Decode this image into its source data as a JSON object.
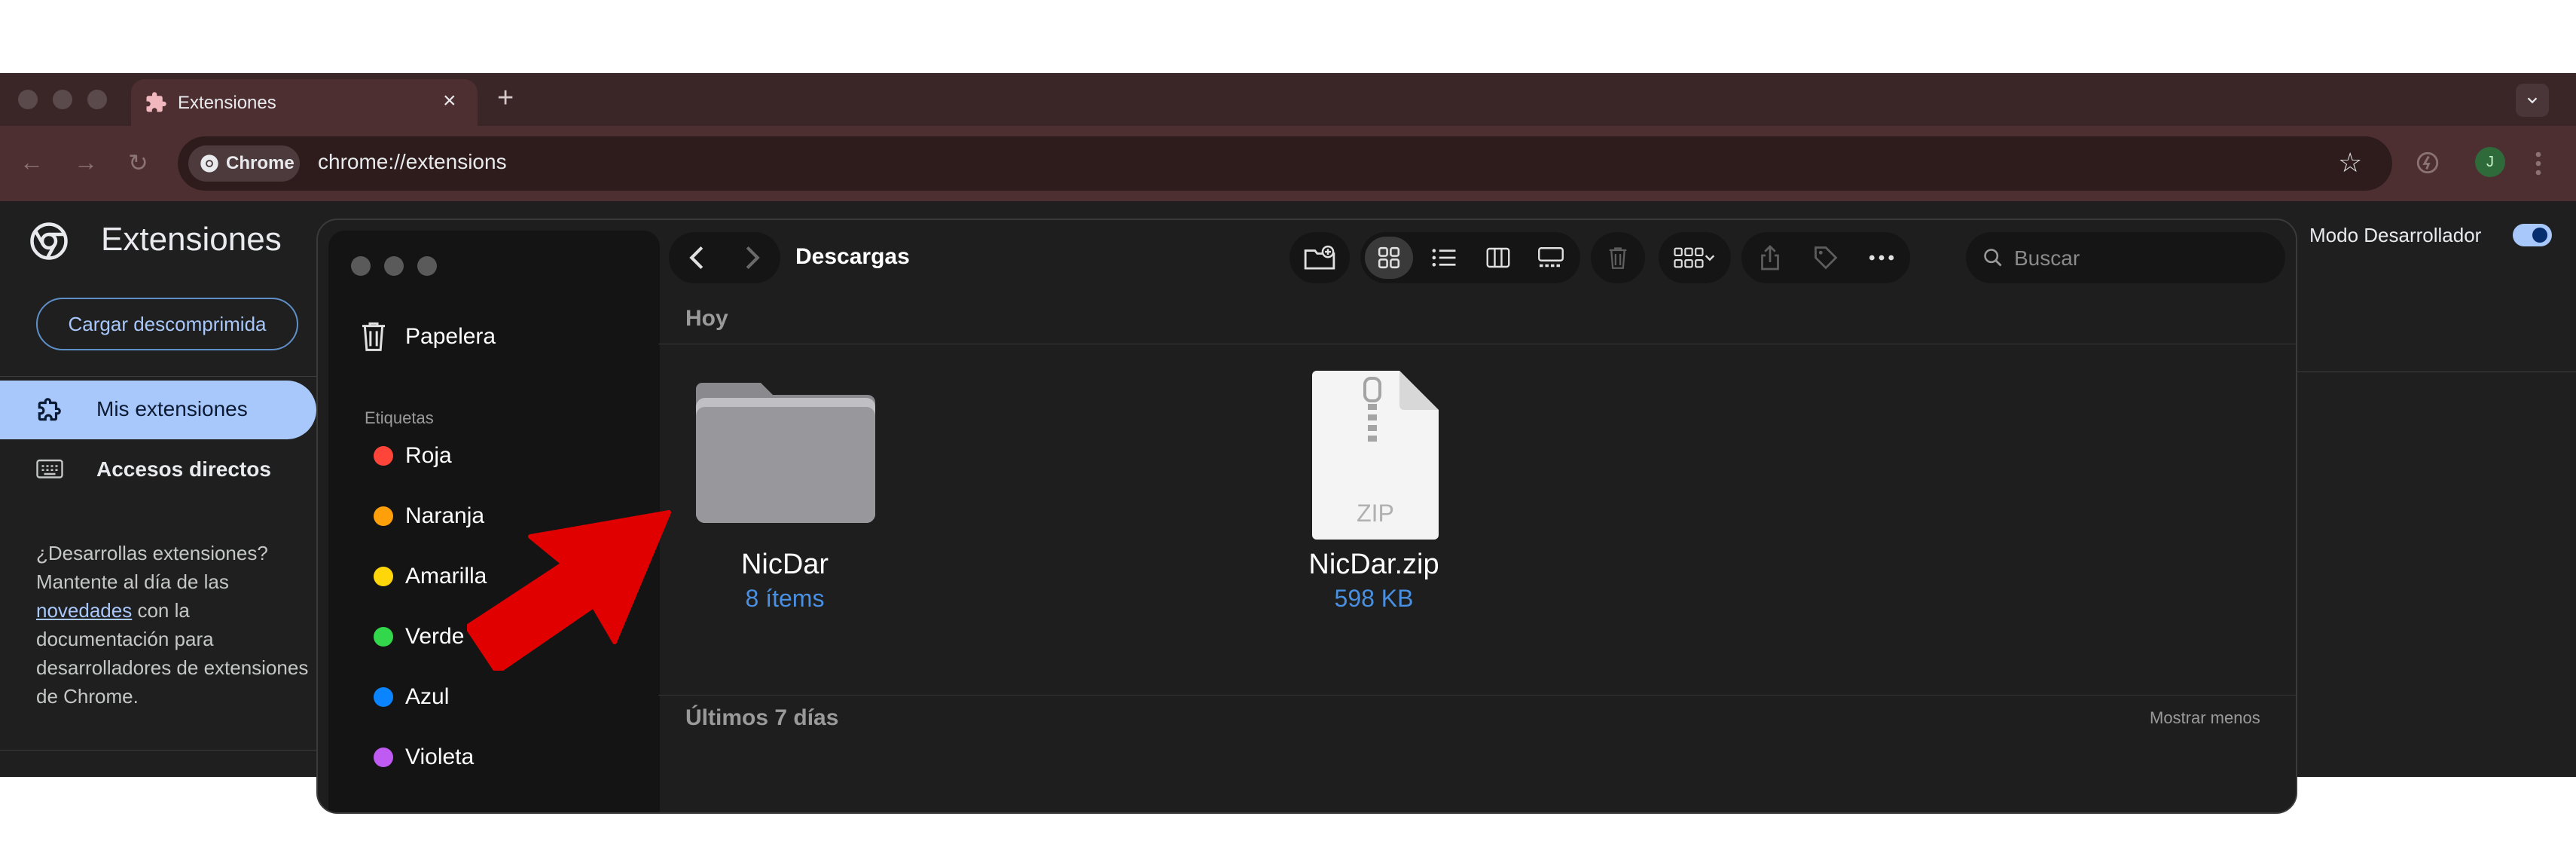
{
  "browser": {
    "tab_title": "Extensiones",
    "chip_label": "Chrome",
    "url": "chrome://extensions",
    "avatar_initial": "J"
  },
  "extensions_page": {
    "title": "Extensiones",
    "load_button": "Cargar descomprimida",
    "nav": [
      {
        "label": "Mis extensiones",
        "active": true
      },
      {
        "label": "Accesos directos",
        "active": false
      }
    ],
    "dev_text_before": "¿Desarrollas extensiones? Mantente al día de las ",
    "dev_link": "novedades",
    "dev_text_after": " con la documentación para desarrolladores de extensiones de Chrome.",
    "dev_mode_label": "Modo Desarrollador",
    "dev_mode_on": true
  },
  "finder": {
    "folder_title": "Descargas",
    "search_placeholder": "Buscar",
    "sidebar": {
      "trash": "Papelera",
      "tags_header": "Etiquetas",
      "tags": [
        {
          "label": "Roja",
          "color": "#ff453a"
        },
        {
          "label": "Naranja",
          "color": "#ff9f0a"
        },
        {
          "label": "Amarilla",
          "color": "#ffd60a"
        },
        {
          "label": "Verde",
          "color": "#32d74b"
        },
        {
          "label": "Azul",
          "color": "#0a84ff"
        },
        {
          "label": "Violeta",
          "color": "#bf5af2"
        }
      ]
    },
    "section_today": "Hoy",
    "section_week": "Últimos 7 días",
    "show_less": "Mostrar menos",
    "files": [
      {
        "name": "NicDar",
        "meta": "8 ítems",
        "kind": "folder-icon"
      },
      {
        "name": "NicDar.zip",
        "meta": "598 KB",
        "kind": "zip-file-icon"
      }
    ],
    "zip_label": "ZIP"
  },
  "annotation": {
    "arrow_color": "#e00000"
  }
}
